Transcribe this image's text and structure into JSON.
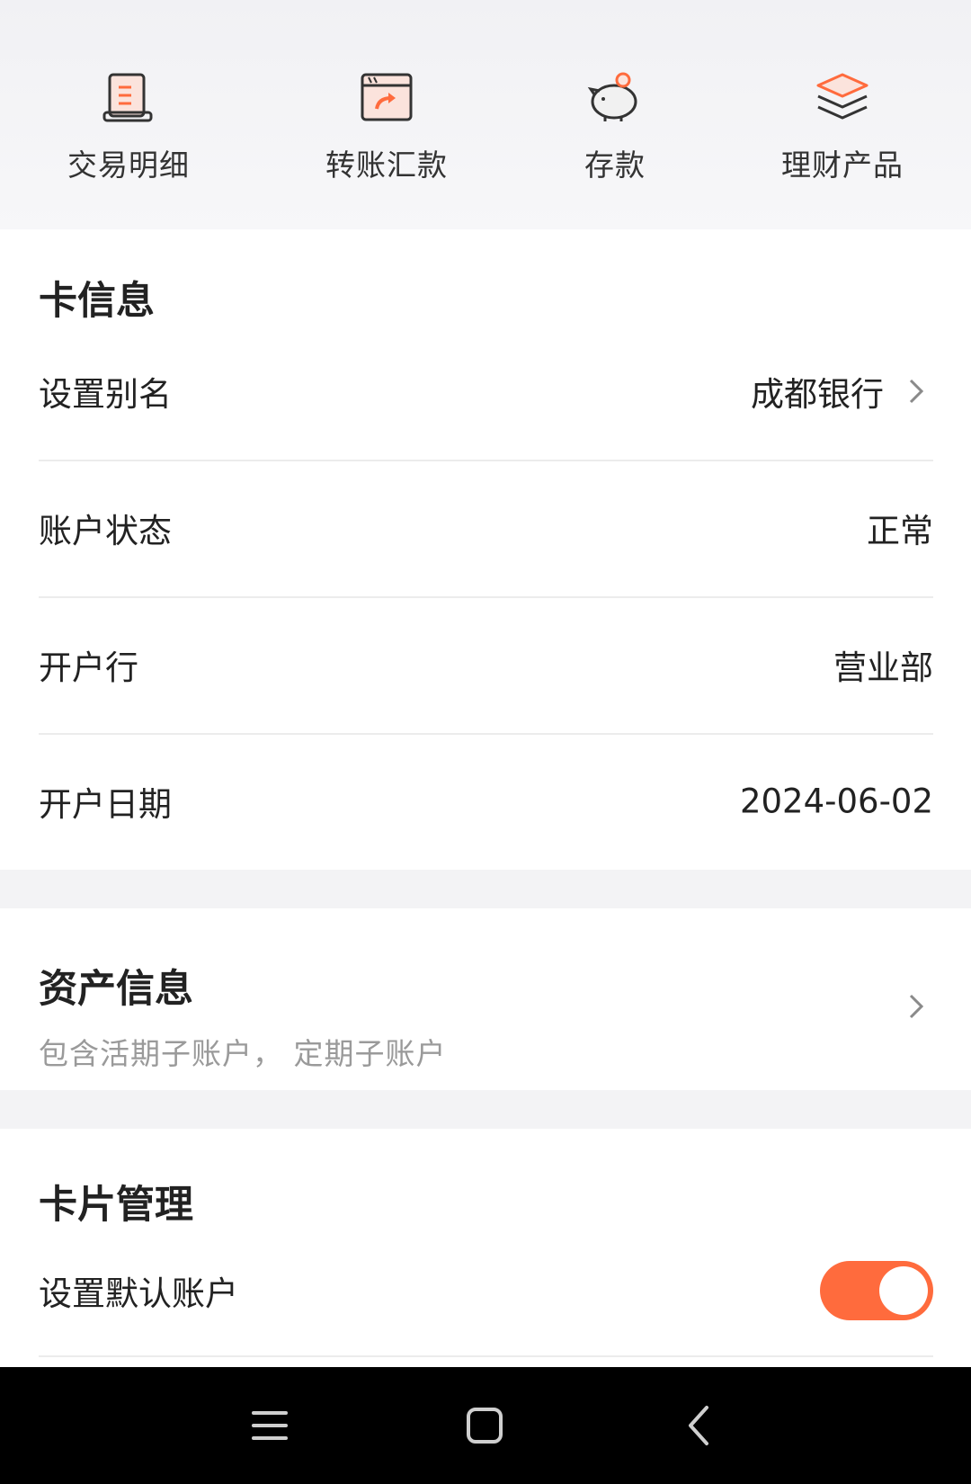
{
  "quick_actions": [
    {
      "label": "交易明细",
      "icon": "receipt-icon"
    },
    {
      "label": "转账汇款",
      "icon": "transfer-icon"
    },
    {
      "label": "存款",
      "icon": "piggy-bank-icon"
    },
    {
      "label": "理财产品",
      "icon": "layers-icon"
    }
  ],
  "card_info": {
    "title": "卡信息",
    "rows": [
      {
        "label": "设置别名",
        "value": "成都银行"
      },
      {
        "label": "账户状态",
        "value": "正常"
      },
      {
        "label": "开户行",
        "value": "营业部"
      },
      {
        "label": "开户日期",
        "value": "2024-06-02"
      }
    ]
  },
  "asset_info": {
    "title": "资产信息",
    "subtitle": "包含活期子账户， 定期子账户"
  },
  "card_management": {
    "title": "卡片管理",
    "rows": [
      {
        "label": "设置默认账户",
        "toggle_on": true
      }
    ]
  },
  "colors": {
    "accent": "#ff6b3d",
    "divider": "#ececec",
    "subtle_text": "#9a9a9a"
  }
}
